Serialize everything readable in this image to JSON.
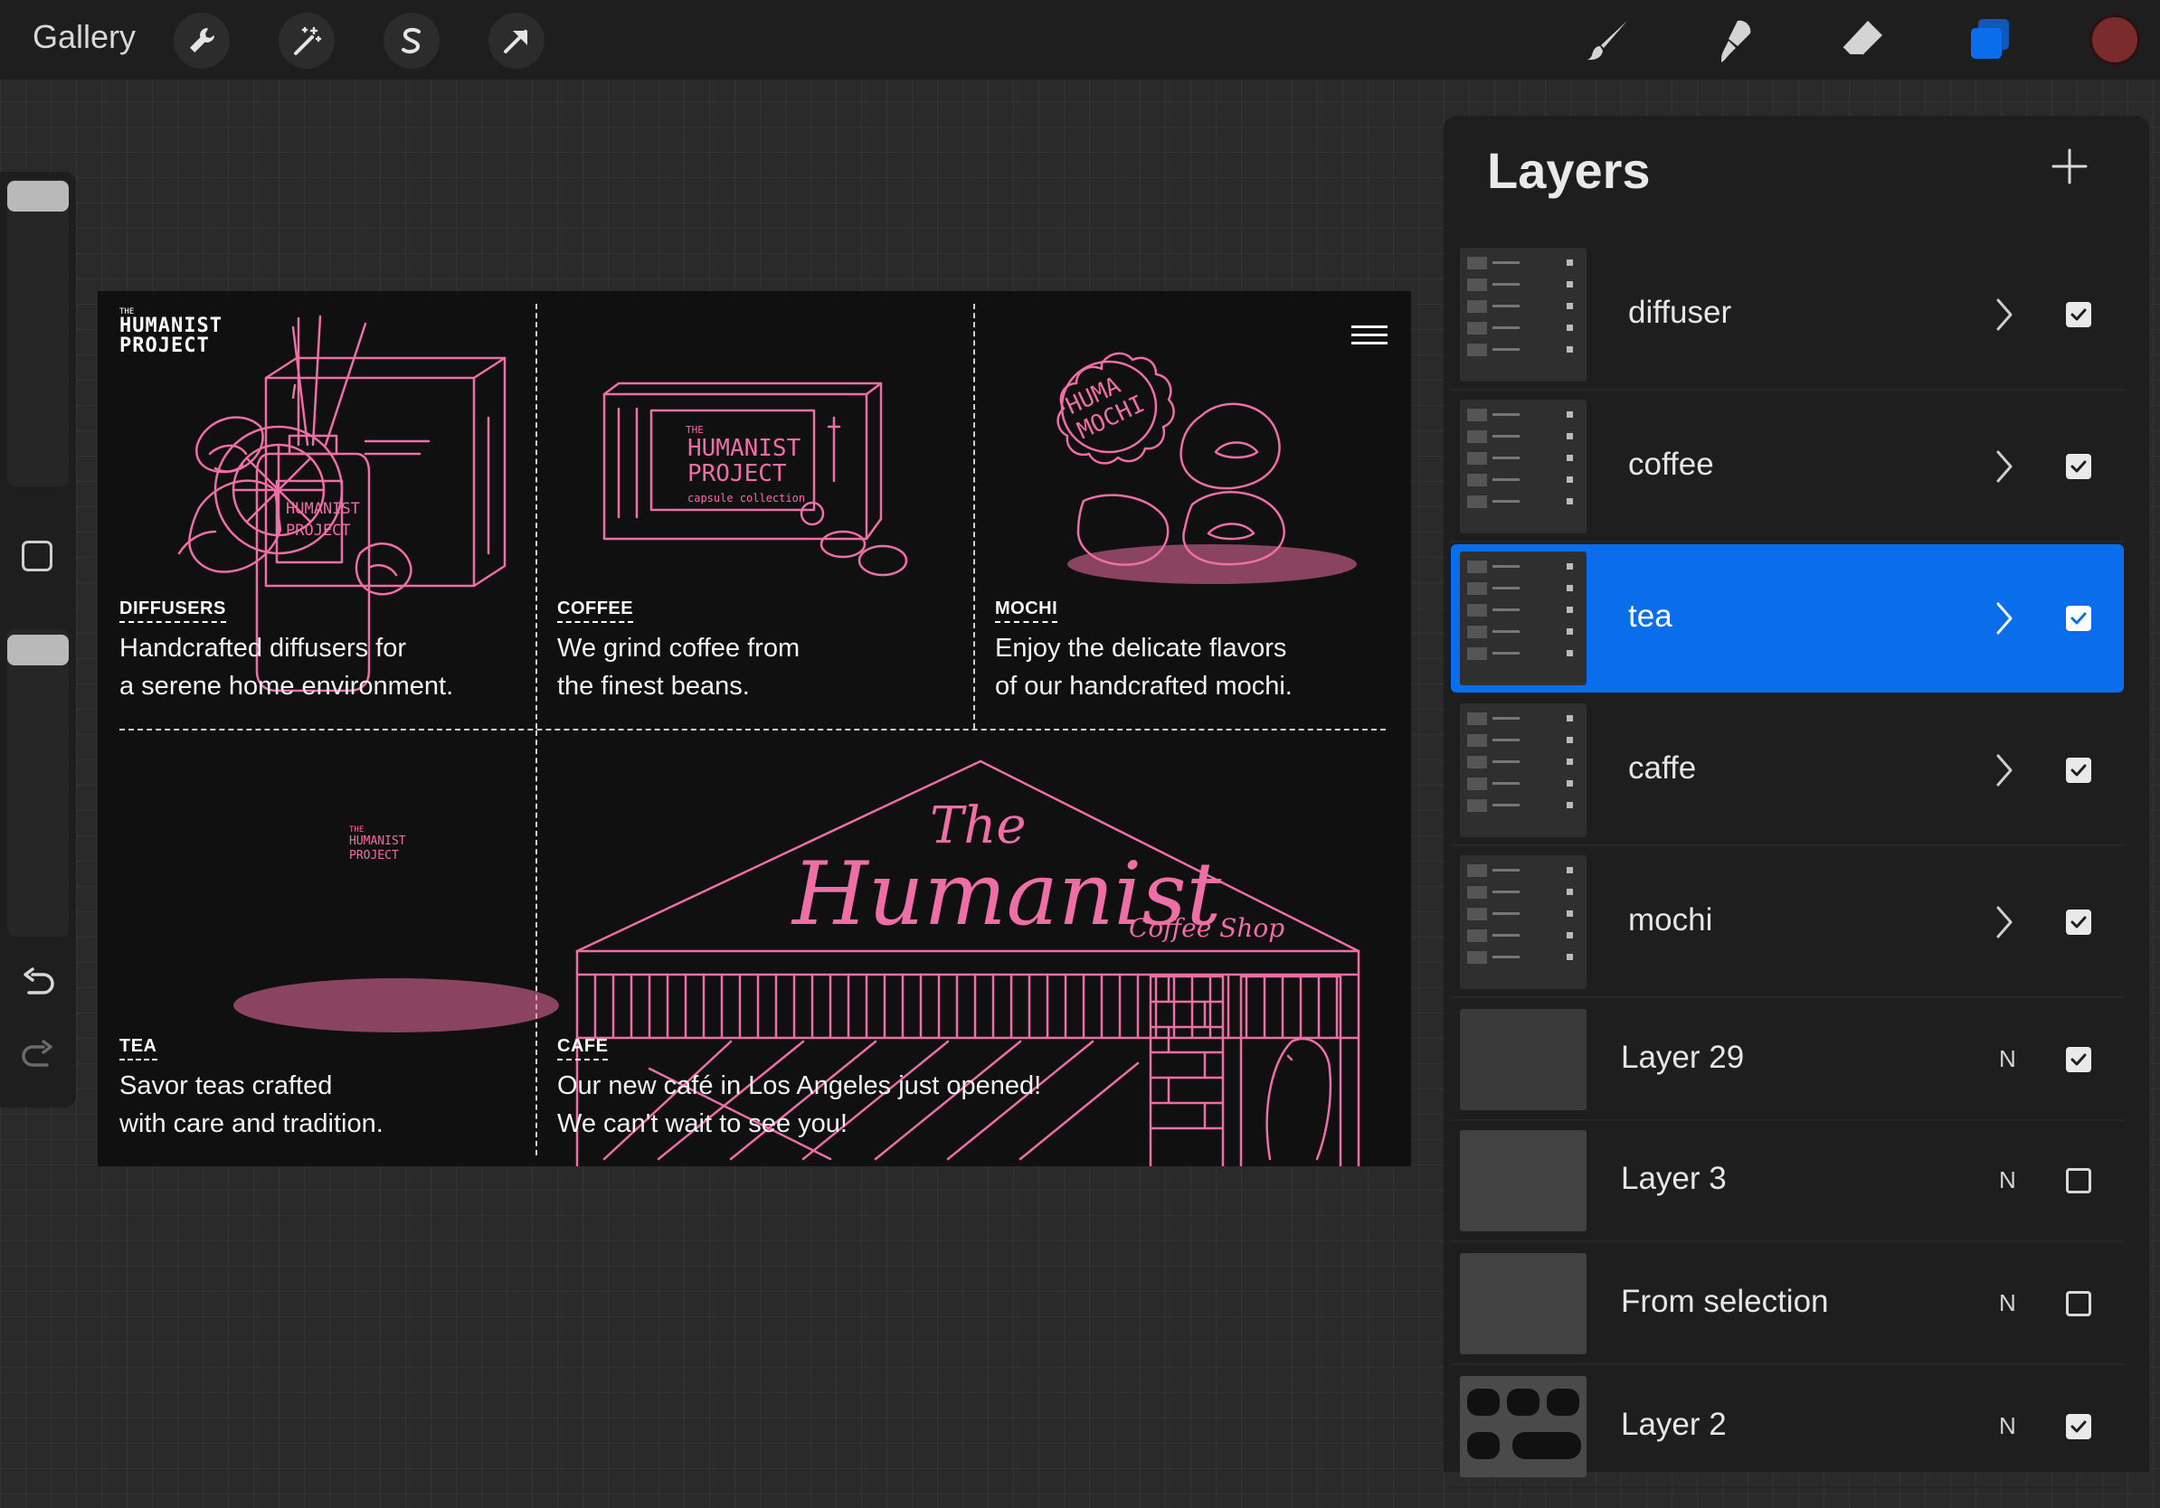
{
  "topbar": {
    "gallery_label": "Gallery",
    "tools": [
      "wrench-icon",
      "magic-wand-icon",
      "selection-s-icon",
      "transform-arrow-icon"
    ],
    "right_tools": [
      "brush-icon",
      "smudge-icon",
      "eraser-icon",
      "layers-icon"
    ],
    "current_color": "#7a2c2c",
    "accent": "#0a6dec"
  },
  "canvas": {
    "brand": {
      "the": "THE",
      "line1": "HUMANIST",
      "line2": "PROJECT"
    },
    "sections": [
      {
        "label": "DIFFUSERS",
        "desc1": "Handcrafted diffusers for",
        "desc2": "a serene home environment."
      },
      {
        "label": "COFFEE",
        "desc1": "We grind coffee from",
        "desc2": "the finest beans."
      },
      {
        "label": "MOCHI",
        "desc1": "Enjoy the delicate flavors",
        "desc2": "of our handcrafted mochi."
      },
      {
        "label": "TEA",
        "desc1": "Savor teas crafted",
        "desc2": "with care and tradition."
      },
      {
        "label": "CAFE",
        "desc1": "Our new café in Los Angeles just opened!",
        "desc2": "We can't wait to see you!"
      }
    ],
    "illustration_text": {
      "diffuser_bottle_1": "HUMANIST",
      "diffuser_bottle_2": "PROJECT",
      "coffee_box_1": "THE",
      "coffee_box_2": "HUMANIST",
      "coffee_box_3": "PROJECT",
      "coffee_box_4": "capsule collection",
      "mochi_badge_1": "HUMA",
      "mochi_badge_2": "MOCHI",
      "tea_box_1": "THE",
      "tea_box_2": "HUMANIST",
      "tea_box_3": "PROJECT",
      "cafe_sign_1": "The",
      "cafe_sign_2": "Humanist",
      "cafe_sign_3": "Coffee Shop"
    },
    "line_color": "#ee6fa6"
  },
  "layers": {
    "title": "Layers",
    "items": [
      {
        "name": "diffuser",
        "type": "group",
        "visible": true,
        "selected": false
      },
      {
        "name": "coffee",
        "type": "group",
        "visible": true,
        "selected": false
      },
      {
        "name": "tea",
        "type": "group",
        "visible": true,
        "selected": true
      },
      {
        "name": "caffe",
        "type": "group",
        "visible": true,
        "selected": false
      },
      {
        "name": "mochi",
        "type": "group",
        "visible": true,
        "selected": false
      },
      {
        "name": "Layer 29",
        "type": "layer",
        "blend": "N",
        "visible": true,
        "selected": false
      },
      {
        "name": "Layer 3",
        "type": "layer",
        "blend": "N",
        "visible": false,
        "selected": false
      },
      {
        "name": "From selection",
        "type": "layer",
        "blend": "N",
        "visible": false,
        "selected": false
      },
      {
        "name": "Layer 2",
        "type": "layer",
        "blend": "N",
        "visible": true,
        "selected": false
      }
    ]
  }
}
